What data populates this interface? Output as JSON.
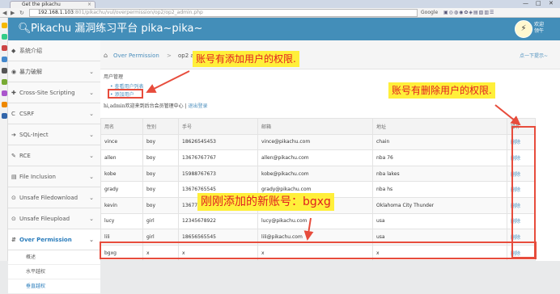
{
  "browser": {
    "tab_title": "Get the pikachu",
    "tab_close": "×",
    "window_controls": [
      "—",
      "□",
      "✕"
    ],
    "url_host": "192.168.1.103",
    "url_path": ":801/pikachu/vul/overpermission/op2/op2_admin.php",
    "search_label": "Google",
    "toolbar_icons": "▣◎◍◉✿◈▤▧▥☰"
  },
  "navbar": {
    "brand_icon": "🔍︎",
    "title": "Pikachu 漏洞练习平台 pika~pika~",
    "avatar_icon": "⚡",
    "welcome_line1": "欢迎",
    "welcome_line2": "领午"
  },
  "sidebar": {
    "items": [
      {
        "icon": "◆",
        "label": "系统介绍",
        "chevron": ""
      },
      {
        "icon": "◉",
        "label": "暴力破解",
        "chevron": "⌄"
      },
      {
        "icon": "✚",
        "label": "Cross-Site Scripting",
        "chevron": "⌄"
      },
      {
        "icon": "C",
        "label": "CSRF",
        "chevron": "⌄"
      },
      {
        "icon": "➔",
        "label": "SQL-Inject",
        "chevron": "⌄"
      },
      {
        "icon": "✎",
        "label": "RCE",
        "chevron": "⌄"
      },
      {
        "icon": "▤",
        "label": "File Inclusion",
        "chevron": "⌄"
      },
      {
        "icon": "⊙",
        "label": "Unsafe Filedownload",
        "chevron": "⌄"
      },
      {
        "icon": "⊙",
        "label": "Unsafe Fileupload",
        "chevron": "⌄"
      },
      {
        "icon": "⇵",
        "label": "Over Permission",
        "chevron": "⌄"
      }
    ],
    "subitems": [
      "概述",
      "水平越权",
      "垂直越权"
    ]
  },
  "breadcrumb": {
    "home_icon": "⌂",
    "link": "Over Permission",
    "separator": ">",
    "current": "op2 admin",
    "hint": "点一下提示~"
  },
  "main": {
    "section_title": "用户管理",
    "links": [
      "查看用户列表",
      "添加用户"
    ],
    "welcome_text": "hi,admin欢迎来到后台会员管理中心 |",
    "logout": "退出登录"
  },
  "table": {
    "headers": [
      "用名",
      "性别",
      "手号",
      "邮箱",
      "地址",
      "操作"
    ],
    "rows": [
      [
        "vince",
        "boy",
        "18626545453",
        "vince@pikachu.com",
        "chain",
        "删除"
      ],
      [
        "allen",
        "boy",
        "13676767767",
        "allen@pikachu.com",
        "nba 76",
        "删除"
      ],
      [
        "kobe",
        "boy",
        "15988767673",
        "kobe@pikachu.com",
        "nba lakes",
        "删除"
      ],
      [
        "grady",
        "boy",
        "13676765545",
        "grady@pikachu.com",
        "nba hs",
        "删除"
      ],
      [
        "kevin",
        "boy",
        "13677676754",
        "kevin@pikachu.com",
        "Oklahoma City Thunder",
        "删除"
      ],
      [
        "lucy",
        "girl",
        "12345678922",
        "lucy@pikachu.com",
        "usa",
        "删除"
      ],
      [
        "lili",
        "girl",
        "18656565545",
        "lili@pikachu.com",
        "usa",
        "删除"
      ],
      [
        "bgxg",
        "x",
        "x",
        "x",
        "x",
        "删除"
      ]
    ]
  },
  "annotations": {
    "add_note": "账号有添加用户的权限.",
    "delete_note": "账号有删除用户的权限.",
    "new_account_note": "刚刚添加的新账号：bgxg",
    "text_color": "#e02020",
    "highlight_color": "#ffef3a"
  }
}
